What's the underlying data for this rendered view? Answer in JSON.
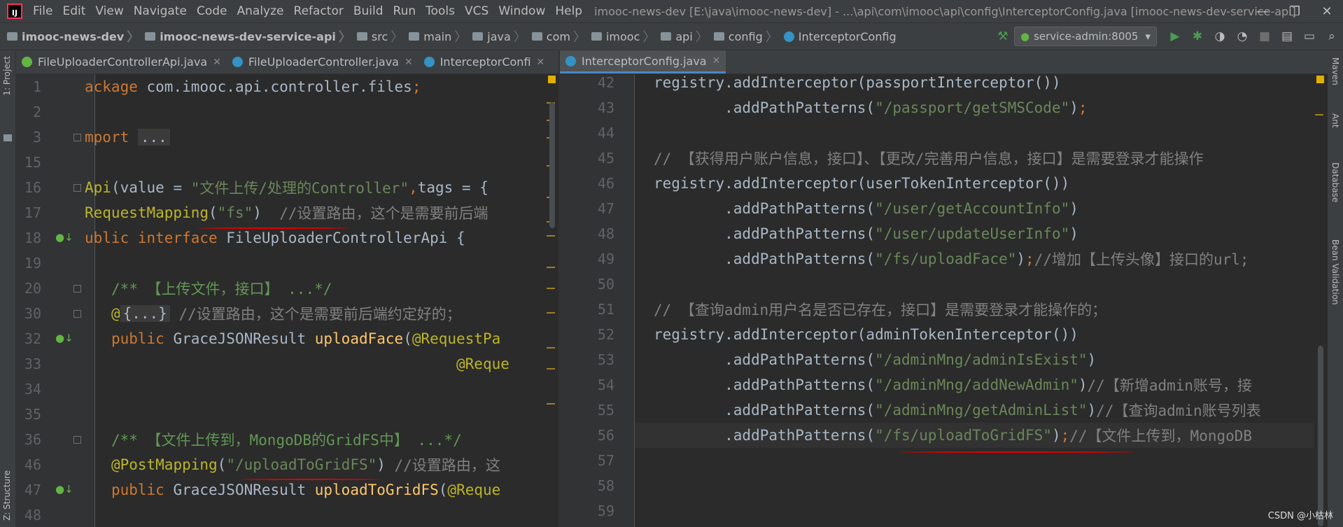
{
  "menubar": {
    "items": [
      "File",
      "Edit",
      "View",
      "Navigate",
      "Code",
      "Analyze",
      "Refactor",
      "Build",
      "Run",
      "Tools",
      "VCS",
      "Window",
      "Help"
    ],
    "title": "imooc-news-dev [E:\\java\\imooc-news-dev] - ...\\api\\com\\imooc\\api\\config\\InterceptorConfig.java [imooc-news-dev-service-api]"
  },
  "breadcrumb": {
    "items": [
      "imooc-news-dev",
      "imooc-news-dev-service-api",
      "src",
      "main",
      "java",
      "com",
      "imooc",
      "api",
      "config",
      "InterceptorConfig"
    ]
  },
  "run_config": "service-admin:8005",
  "left_tabs": [
    {
      "label": "FileUploaderControllerApi.java",
      "icon": "interface-icon",
      "color": "#62b543"
    },
    {
      "label": "FileUploaderController.java",
      "icon": "class-icon",
      "color": "#3592c4"
    },
    {
      "label": "InterceptorConfi",
      "icon": "class-icon",
      "color": "#3592c4"
    }
  ],
  "left_tab_overflow": "8",
  "right_tabs": [
    {
      "label": "InterceptorConfig.java",
      "icon": "class-icon",
      "color": "#3592c4"
    }
  ],
  "side_left": [
    "1: Project",
    "Z: Structure"
  ],
  "side_right": [
    "Maven",
    "Ant",
    "Database",
    "Bean Validation"
  ],
  "left_editor": {
    "lines": [
      {
        "num": "1",
        "parts": [
          [
            "kw",
            "ackage "
          ],
          [
            "plain",
            "com.imooc.api.controller.files"
          ],
          [
            "kw",
            ";"
          ]
        ]
      },
      {
        "num": "2",
        "parts": []
      },
      {
        "num": "3",
        "parts": [
          [
            "kw",
            "mport "
          ],
          [
            "fold",
            "..."
          ]
        ]
      },
      {
        "num": "15",
        "parts": []
      },
      {
        "num": "16",
        "parts": [
          [
            "ann",
            "Api"
          ],
          [
            "plain",
            "(value = "
          ],
          [
            "str",
            "\"文件上传/处理的Controller\""
          ],
          [
            "kw",
            ","
          ],
          [
            "plain",
            "tags = {"
          ]
        ]
      },
      {
        "num": "17",
        "parts": [
          [
            "ann",
            "RequestMapping"
          ],
          [
            "plain",
            "("
          ],
          [
            "str",
            "\"fs\""
          ],
          [
            "plain",
            ")  "
          ],
          [
            "cm",
            "//设置路由，这个是需要前后端"
          ]
        ]
      },
      {
        "num": "18",
        "parts": [
          [
            "kw",
            "ublic interface "
          ],
          [
            "plain",
            "FileUploaderControllerApi {"
          ]
        ]
      },
      {
        "num": "19",
        "parts": []
      },
      {
        "num": "20",
        "parts": [
          [
            "plain",
            "   "
          ],
          [
            "doc",
            "/** 【上传文件，接口】 ...*/"
          ]
        ]
      },
      {
        "num": "30",
        "parts": [
          [
            "plain",
            "   "
          ],
          [
            "ann",
            "@"
          ],
          [
            "fold",
            "{...}"
          ],
          [
            "cm",
            " //设置路由，这个是需要前后端约定好的；"
          ]
        ]
      },
      {
        "num": "32",
        "parts": [
          [
            "plain",
            "   "
          ],
          [
            "kw",
            "public "
          ],
          [
            "plain",
            "GraceJSONResult "
          ],
          [
            "fn",
            "uploadFace"
          ],
          [
            "plain",
            "("
          ],
          [
            "ann",
            "@RequestPa"
          ]
        ]
      },
      {
        "num": "33",
        "parts": [
          [
            "plain",
            "                                          "
          ],
          [
            "ann",
            "@Reque"
          ]
        ]
      },
      {
        "num": "34",
        "parts": []
      },
      {
        "num": "35",
        "parts": []
      },
      {
        "num": "36",
        "parts": [
          [
            "plain",
            "   "
          ],
          [
            "doc",
            "/** 【文件上传到，MongoDB的GridFS中】 ...*/"
          ]
        ]
      },
      {
        "num": "46",
        "parts": [
          [
            "plain",
            "   "
          ],
          [
            "ann",
            "@PostMapping"
          ],
          [
            "plain",
            "("
          ],
          [
            "str",
            "\"/uploadToGridFS\""
          ],
          [
            "plain",
            ") "
          ],
          [
            "cm",
            "//设置路由，这"
          ]
        ]
      },
      {
        "num": "47",
        "parts": [
          [
            "plain",
            "   "
          ],
          [
            "kw",
            "public "
          ],
          [
            "plain",
            "GraceJSONResult "
          ],
          [
            "fn",
            "uploadToGridFS"
          ],
          [
            "plain",
            "("
          ],
          [
            "ann",
            "@Reque"
          ]
        ]
      },
      {
        "num": "48",
        "parts": []
      }
    ]
  },
  "right_editor": {
    "lines": [
      {
        "num": "42",
        "parts": [
          [
            "plain",
            "registry.addInterceptor(passportInterceptor())"
          ]
        ]
      },
      {
        "num": "43",
        "parts": [
          [
            "plain",
            "        .addPathPatterns("
          ],
          [
            "str",
            "\"/passport/getSMSCode\""
          ],
          [
            "plain",
            ")"
          ],
          [
            "kw",
            ";"
          ]
        ]
      },
      {
        "num": "44",
        "parts": []
      },
      {
        "num": "45",
        "parts": [
          [
            "cm",
            "// 【获得用户账户信息，接口】、【更改/完善用户信息，接口】是需要登录才能操作"
          ]
        ]
      },
      {
        "num": "46",
        "parts": [
          [
            "plain",
            "registry.addInterceptor(userTokenInterceptor())"
          ]
        ]
      },
      {
        "num": "47",
        "parts": [
          [
            "plain",
            "        .addPathPatterns("
          ],
          [
            "str",
            "\"/user/getAccountInfo\""
          ],
          [
            "plain",
            ")"
          ]
        ]
      },
      {
        "num": "48",
        "parts": [
          [
            "plain",
            "        .addPathPatterns("
          ],
          [
            "str",
            "\"/user/updateUserInfo\""
          ],
          [
            "plain",
            ")"
          ]
        ]
      },
      {
        "num": "49",
        "parts": [
          [
            "plain",
            "        .addPathPatterns("
          ],
          [
            "str",
            "\"/fs/uploadFace\""
          ],
          [
            "plain",
            ")"
          ],
          [
            "kw",
            ";"
          ],
          [
            "cm",
            "//增加【上传头像】接口的url;"
          ]
        ]
      },
      {
        "num": "50",
        "parts": []
      },
      {
        "num": "51",
        "parts": [
          [
            "cm",
            "// 【查询admin用户名是否已存在，接口】是需要登录才能操作的；"
          ]
        ]
      },
      {
        "num": "52",
        "parts": [
          [
            "plain",
            "registry.addInterceptor(adminTokenInterceptor())"
          ]
        ]
      },
      {
        "num": "53",
        "parts": [
          [
            "plain",
            "        .addPathPatterns("
          ],
          [
            "str",
            "\"/adminMng/adminIsExist\""
          ],
          [
            "plain",
            ")"
          ]
        ]
      },
      {
        "num": "54",
        "parts": [
          [
            "plain",
            "        .addPathPatterns("
          ],
          [
            "str",
            "\"/adminMng/addNewAdmin\""
          ],
          [
            "plain",
            ")"
          ],
          [
            "cm",
            "//【新增admin账号，接"
          ]
        ]
      },
      {
        "num": "55",
        "parts": [
          [
            "plain",
            "        .addPathPatterns("
          ],
          [
            "str",
            "\"/adminMng/getAdminList\""
          ],
          [
            "plain",
            ")"
          ],
          [
            "cm",
            "//【查询admin账号列表"
          ]
        ]
      },
      {
        "num": "56",
        "parts": [
          [
            "plain",
            "        .addPathPatterns("
          ],
          [
            "str",
            "\"/fs/uploadToGridFS\""
          ],
          [
            "plain",
            ")"
          ],
          [
            "kw",
            ";"
          ],
          [
            "cm",
            "//【文件上传到，MongoDB"
          ]
        ]
      },
      {
        "num": "57",
        "parts": []
      },
      {
        "num": "58",
        "parts": []
      },
      {
        "num": "59",
        "parts": []
      }
    ]
  },
  "watermark": "CSDN @小枯林",
  "colors": {
    "accent": "#4a88c7",
    "annotation_underline": "#e00000"
  }
}
